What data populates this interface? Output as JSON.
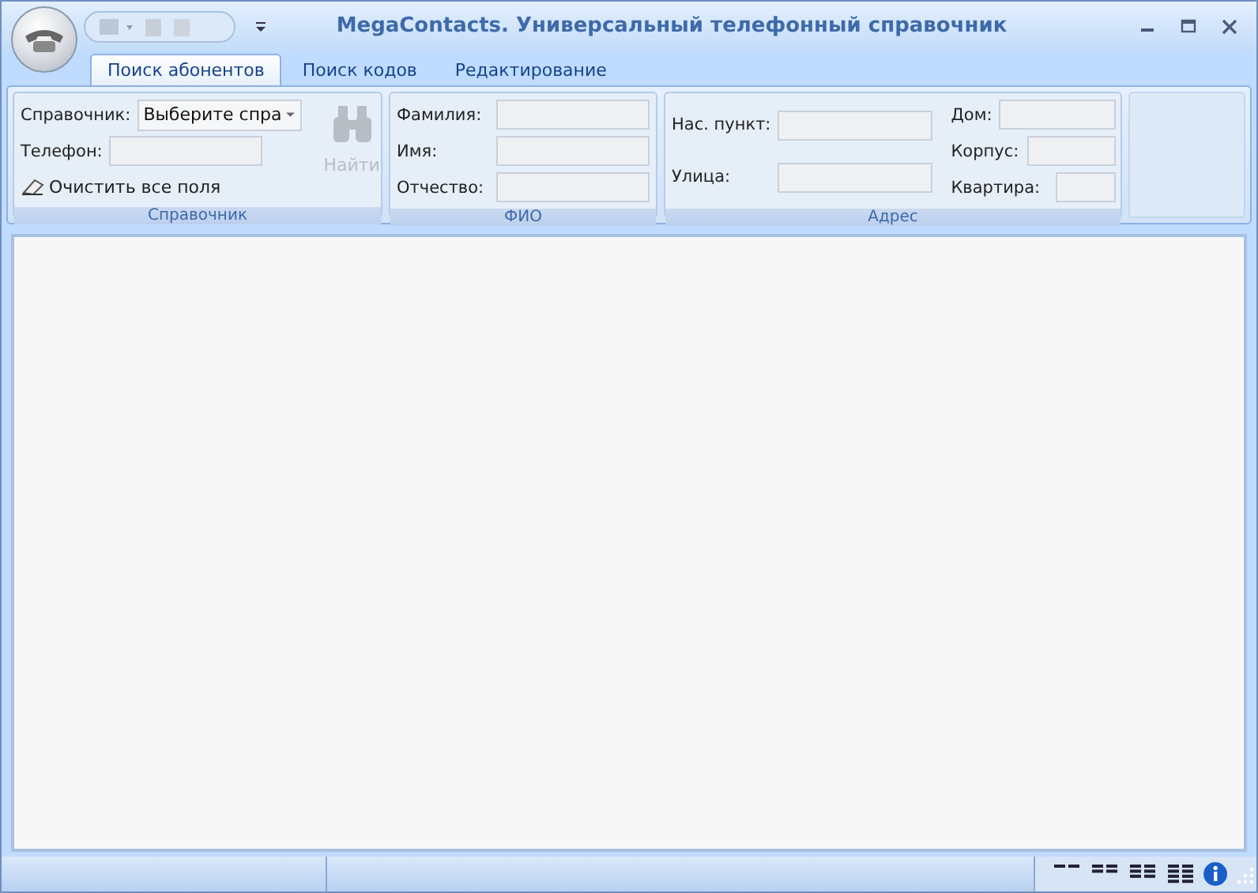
{
  "window": {
    "title": "MegaContacts. Универсальный телефонный справочник"
  },
  "tabs": [
    {
      "label": "Поиск абонентов",
      "selected": true
    },
    {
      "label": "Поиск кодов",
      "selected": false
    },
    {
      "label": "Редактирование",
      "selected": false
    }
  ],
  "directory_group": {
    "title": "Справочник",
    "directory_label": "Справочник:",
    "directory_value": "Выберите спра",
    "phone_label": "Телефон:",
    "clear_button": "Очистить все поля",
    "find_button": {
      "label": "Найти",
      "disabled": true
    }
  },
  "name_group": {
    "title": "ФИО",
    "fields": [
      {
        "label": "Фамилия:"
      },
      {
        "label": "Имя:"
      },
      {
        "label": "Отчество:"
      }
    ]
  },
  "address_group": {
    "title": "Адрес",
    "fields": [
      {
        "label": "Нас. пункт:"
      },
      {
        "label": "Улица:"
      }
    ],
    "house_fields": [
      {
        "label": "Дом:"
      },
      {
        "label": "Корпус:"
      },
      {
        "label": "Квартира:"
      }
    ]
  }
}
